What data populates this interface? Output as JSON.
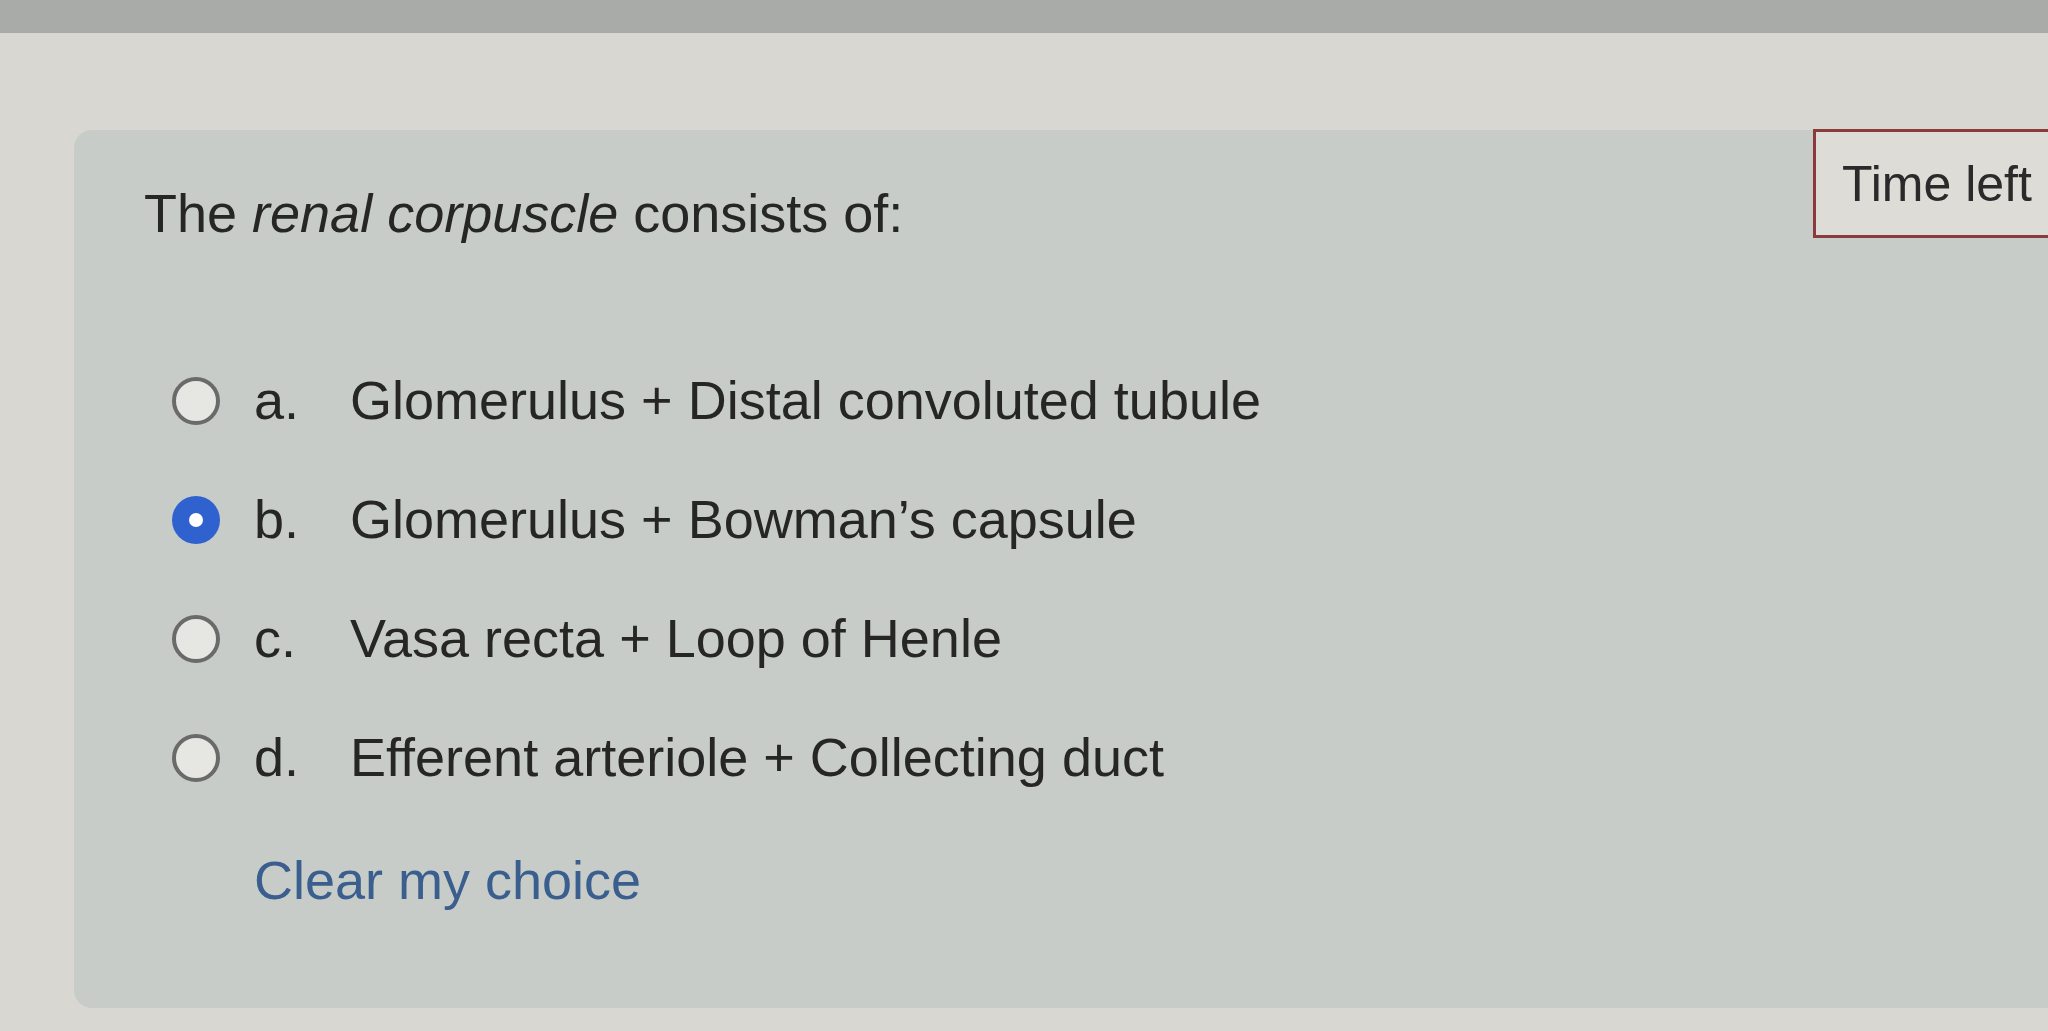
{
  "question": {
    "text": "The *renal corpuscle* consists of:"
  },
  "timer": {
    "label": "Time left"
  },
  "options": [
    {
      "letter": "a.",
      "text": "Glomerulus + Distal convoluted tubule",
      "selected": false
    },
    {
      "letter": "b.",
      "text": "Glomerulus + Bowman’s capsule",
      "selected": true
    },
    {
      "letter": "c.",
      "text": "Vasa recta + Loop of Henle",
      "selected": false
    },
    {
      "letter": "d.",
      "text": "Efferent arteriole + Collecting duct",
      "selected": false
    }
  ],
  "clear_link": "Clear my choice"
}
